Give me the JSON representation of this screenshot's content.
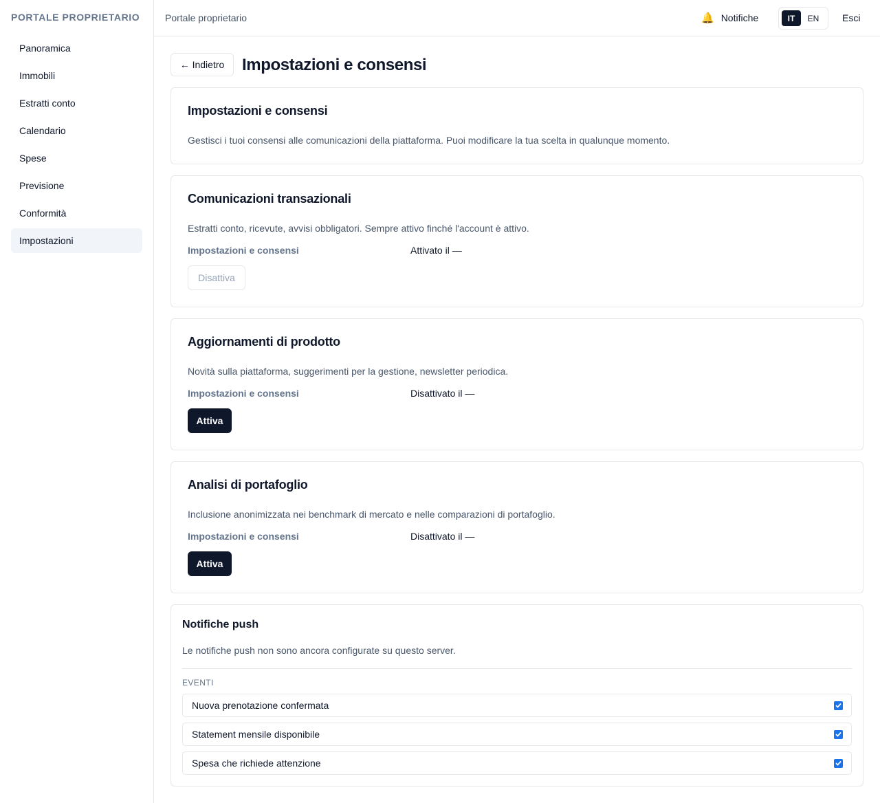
{
  "sidebar": {
    "brand": "PORTALE PROPRIETARIO",
    "items": [
      {
        "label": "Panoramica"
      },
      {
        "label": "Immobili"
      },
      {
        "label": "Estratti conto"
      },
      {
        "label": "Calendario"
      },
      {
        "label": "Spese"
      },
      {
        "label": "Previsione"
      },
      {
        "label": "Conformità"
      },
      {
        "label": "Impostazioni",
        "active": true
      }
    ]
  },
  "header": {
    "title": "Portale proprietario",
    "notifications_label": "Notifiche",
    "notifications_icon": "bell-icon",
    "languages": [
      "IT",
      "EN"
    ],
    "active_language": "IT",
    "logout_label": "Esci"
  },
  "page": {
    "back_label": "← Indietro",
    "title": "Impostazioni e consensi"
  },
  "intro_card": {
    "title": "Impostazioni e consensi",
    "description": "Gestisci i tuoi consensi alle comunicazioni della piattaforma. Puoi modificare la tua scelta in qualunque momento."
  },
  "consents": [
    {
      "title": "Comunicazioni transazionali",
      "description": "Estratti conto, ricevute, avvisi obbligatori. Sempre attivo finché l'account è attivo.",
      "row_label": "Impostazioni e consensi",
      "status": "Attivato il —",
      "button_label": "Disattiva",
      "button_disabled": true
    },
    {
      "title": "Aggiornamenti di prodotto",
      "description": "Novità sulla piattaforma, suggerimenti per la gestione, newsletter periodica.",
      "row_label": "Impostazioni e consensi",
      "status": "Disattivato il —",
      "button_label": "Attiva",
      "button_disabled": false
    },
    {
      "title": "Analisi di portafoglio",
      "description": "Inclusione anonimizzata nei benchmark di mercato e nelle comparazioni di portafoglio.",
      "row_label": "Impostazioni e consensi",
      "status": "Disattivato il —",
      "button_label": "Attiva",
      "button_disabled": false
    }
  ],
  "push": {
    "title": "Notifiche push",
    "description": "Le notifiche push non sono ancora configurate su questo server.",
    "events_label": "EVENTI",
    "events": [
      {
        "label": "Nuova prenotazione confermata",
        "checked": true
      },
      {
        "label": "Statement mensile disponibile",
        "checked": true
      },
      {
        "label": "Spesa che richiede attenzione",
        "checked": true
      }
    ]
  },
  "colors": {
    "primary": "#0f172a",
    "muted": "#475569",
    "border": "#e5e7eb",
    "checkbox": "#1a73e8"
  }
}
